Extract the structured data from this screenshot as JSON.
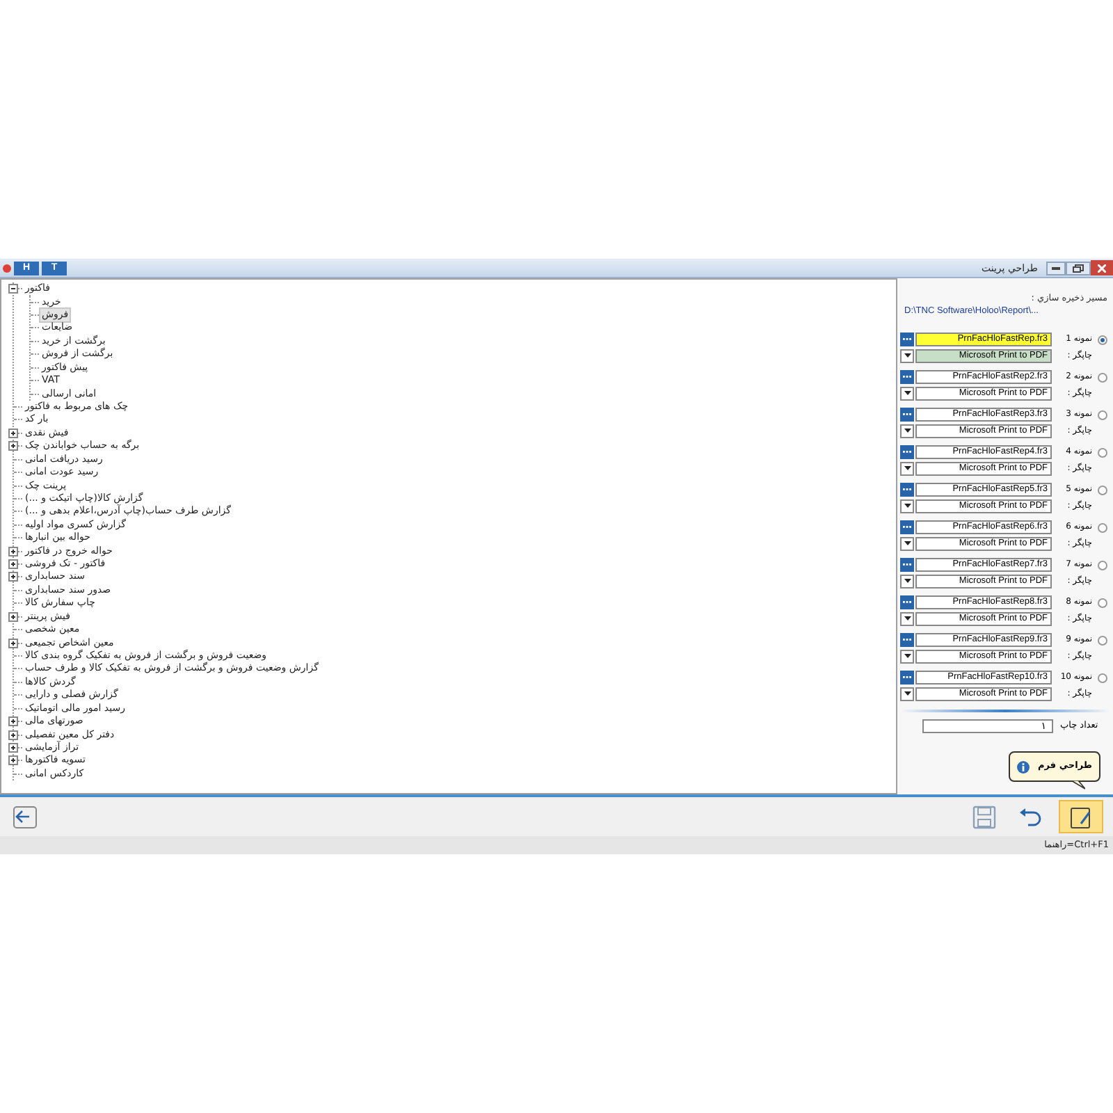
{
  "window": {
    "title": "طراحي پرينت",
    "header_buttons": [
      "T",
      "H"
    ]
  },
  "tree": [
    {
      "label": "فاکتور",
      "kind": "folder",
      "expanded": true,
      "selected": false,
      "children": [
        {
          "label": "خرید",
          "kind": "leaf",
          "selected": false
        },
        {
          "label": "فروش",
          "kind": "leaf",
          "selected": true
        },
        {
          "label": "ضایعات",
          "kind": "leaf",
          "selected": false
        },
        {
          "label": "برگشت از خرید",
          "kind": "leaf",
          "selected": false
        },
        {
          "label": "برگشت از فروش",
          "kind": "leaf",
          "selected": false
        },
        {
          "label": "پیش فاکتور",
          "kind": "leaf",
          "selected": false
        },
        {
          "label": "VAT",
          "kind": "leaf",
          "selected": false
        },
        {
          "label": "امانی ارسالی",
          "kind": "leaf",
          "selected": false
        }
      ]
    },
    {
      "label": "چک های مربوط به فاکتور",
      "kind": "leaf",
      "selected": false
    },
    {
      "label": "بار کد",
      "kind": "leaf",
      "selected": false
    },
    {
      "label": "فیش نقدی",
      "kind": "folder",
      "expanded": false,
      "selected": false
    },
    {
      "label": "برگه به حساب خواباندن چک",
      "kind": "folder",
      "expanded": false,
      "selected": false
    },
    {
      "label": "رسید دریافت امانی",
      "kind": "leaf",
      "selected": false
    },
    {
      "label": "رسید عودت امانی",
      "kind": "leaf",
      "selected": false
    },
    {
      "label": "پرینت چک",
      "kind": "leaf",
      "selected": false
    },
    {
      "label": "گزارش کالا(چاپ اتیکت و ...)",
      "kind": "leaf",
      "selected": false
    },
    {
      "label": "گزارش طرف حساب(چاپ آدرس،اعلام بدهی و ...)",
      "kind": "leaf",
      "selected": false
    },
    {
      "label": "گزارش کسری مواد اولیه",
      "kind": "leaf",
      "selected": false
    },
    {
      "label": "حواله بین انبارها",
      "kind": "leaf",
      "selected": false
    },
    {
      "label": "حواله خروج در فاکتور",
      "kind": "folder",
      "expanded": false,
      "selected": false
    },
    {
      "label": "فاکتور - تک فروشی",
      "kind": "folder",
      "expanded": false,
      "selected": false
    },
    {
      "label": "سند حسابداری",
      "kind": "folder",
      "expanded": false,
      "selected": false
    },
    {
      "label": "صدور سند حسابداری",
      "kind": "leaf",
      "selected": false
    },
    {
      "label": "چاپ سفارش کالا",
      "kind": "leaf",
      "selected": false
    },
    {
      "label": "فیش پرینتر",
      "kind": "folder",
      "expanded": false,
      "selected": false
    },
    {
      "label": "معین شخصی",
      "kind": "leaf",
      "selected": false
    },
    {
      "label": "معین اشخاص تجمیعی",
      "kind": "folder",
      "expanded": false,
      "selected": false
    },
    {
      "label": "وضعیت فروش و برگشت از فروش به تفکیک گروه بندی کالا",
      "kind": "leaf",
      "selected": false
    },
    {
      "label": "گزارش وضعیت فروش و برگشت از فروش به تفکیک کالا و طرف حساب",
      "kind": "leaf",
      "selected": false
    },
    {
      "label": "گردش کالاها",
      "kind": "leaf",
      "selected": false
    },
    {
      "label": "گزارش فصلی و دارایی",
      "kind": "leaf",
      "selected": false
    },
    {
      "label": "رسید امور مالی اتوماتیک",
      "kind": "leaf",
      "selected": false
    },
    {
      "label": "صورتهای مالی",
      "kind": "folder",
      "expanded": false,
      "selected": false
    },
    {
      "label": "دفتر کل معین تفصیلی",
      "kind": "folder",
      "expanded": false,
      "selected": false
    },
    {
      "label": "تراز آزمایشی",
      "kind": "folder",
      "expanded": false,
      "selected": false
    },
    {
      "label": "تسویه فاکتورها",
      "kind": "folder",
      "expanded": false,
      "selected": false
    },
    {
      "label": "کاردکس امانی",
      "kind": "leaf",
      "selected": false
    }
  ],
  "save_path": {
    "label": "مسير ذخيره سازي :",
    "value": "D:\\TNC Software\\Holoo\\Report\\..."
  },
  "samples": [
    {
      "label": "نمونه 1",
      "file": "PrnFacHloFastRep.fr3",
      "printer_label": "چاپگر :",
      "printer": "Microsoft Print to PDF",
      "selected": true
    },
    {
      "label": "نمونه 2",
      "file": "PrnFacHloFastRep2.fr3",
      "printer_label": "چاپگر :",
      "printer": "Microsoft Print to PDF",
      "selected": false
    },
    {
      "label": "نمونه 3",
      "file": "PrnFacHloFastRep3.fr3",
      "printer_label": "چاپگر :",
      "printer": "Microsoft Print to PDF",
      "selected": false
    },
    {
      "label": "نمونه 4",
      "file": "PrnFacHloFastRep4.fr3",
      "printer_label": "چاپگر :",
      "printer": "Microsoft Print to PDF",
      "selected": false
    },
    {
      "label": "نمونه 5",
      "file": "PrnFacHloFastRep5.fr3",
      "printer_label": "چاپگر :",
      "printer": "Microsoft Print to PDF",
      "selected": false
    },
    {
      "label": "نمونه 6",
      "file": "PrnFacHloFastRep6.fr3",
      "printer_label": "چاپگر :",
      "printer": "Microsoft Print to PDF",
      "selected": false
    },
    {
      "label": "نمونه 7",
      "file": "PrnFacHloFastRep7.fr3",
      "printer_label": "چاپگر :",
      "printer": "Microsoft Print to PDF",
      "selected": false
    },
    {
      "label": "نمونه 8",
      "file": "PrnFacHloFastRep8.fr3",
      "printer_label": "چاپگر :",
      "printer": "Microsoft Print to PDF",
      "selected": false
    },
    {
      "label": "نمونه 9",
      "file": "PrnFacHloFastRep9.fr3",
      "printer_label": "چاپگر :",
      "printer": "Microsoft Print to PDF",
      "selected": false
    },
    {
      "label": "نمونه 10",
      "file": "PrnFacHloFastRep10.fr3",
      "printer_label": "چاپگر :",
      "printer": "Microsoft Print to PDF",
      "selected": false
    }
  ],
  "print_count": {
    "label": "تعداد چاپ",
    "value": "١"
  },
  "tooltip": {
    "text": "طراحي فرم"
  },
  "toolbar": [
    {
      "kind": "back",
      "highlighted": false
    },
    {
      "kind": "save",
      "highlighted": false
    },
    {
      "kind": "undo",
      "highlighted": false
    },
    {
      "kind": "design",
      "highlighted": true
    }
  ],
  "status_bar": {
    "text": "Ctrl+F1=راهنما"
  }
}
